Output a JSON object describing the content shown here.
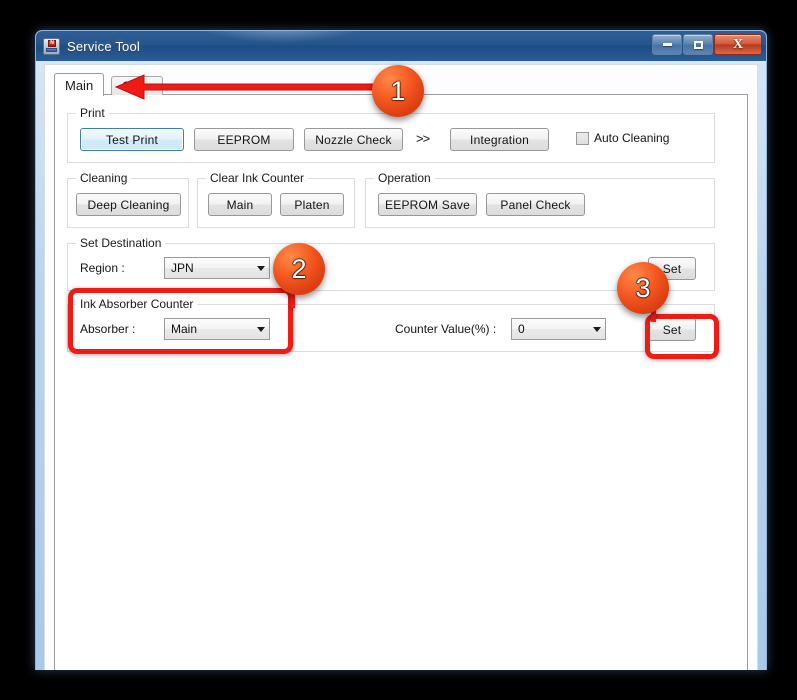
{
  "window": {
    "title": "Service Tool",
    "icon": "printer-icon",
    "controls": {
      "minimize": "minimize-icon",
      "maximize": "maximize-icon",
      "close": "X"
    }
  },
  "tabs": [
    {
      "label": "Main",
      "selected": true
    },
    {
      "label": "Other",
      "selected": false
    }
  ],
  "groups": {
    "print": {
      "title": "Print",
      "buttons": [
        {
          "label": "Test Print",
          "focused": true
        },
        {
          "label": "EEPROM",
          "focused": false
        },
        {
          "label": "Nozzle Check",
          "focused": false
        },
        {
          "label": "Integration",
          "focused": false
        }
      ],
      "chevron": ">>",
      "checkbox": {
        "label": "Auto Cleaning",
        "checked": false
      }
    },
    "cleaning": {
      "title": "Cleaning",
      "buttons": [
        {
          "label": "Deep Cleaning"
        }
      ]
    },
    "clear_ink_counter": {
      "title": "Clear Ink Counter",
      "buttons": [
        {
          "label": "Main"
        },
        {
          "label": "Platen"
        }
      ]
    },
    "operation": {
      "title": "Operation",
      "buttons": [
        {
          "label": "EEPROM Save"
        },
        {
          "label": "Panel Check"
        }
      ]
    },
    "set_destination": {
      "title": "Set Destination",
      "region_label": "Region :",
      "region_value": "JPN",
      "set_label": "Set"
    },
    "ink_absorber_counter": {
      "title": "Ink Absorber Counter",
      "absorber_label": "Absorber :",
      "absorber_value": "Main",
      "counter_label": "Counter Value(%) :",
      "counter_value": "0",
      "set_label": "Set"
    }
  },
  "annotations": {
    "markers": [
      {
        "number": "1"
      },
      {
        "number": "2"
      },
      {
        "number": "3"
      }
    ],
    "highlight_color": "#f01b14",
    "marker_color": "#f4571f"
  }
}
